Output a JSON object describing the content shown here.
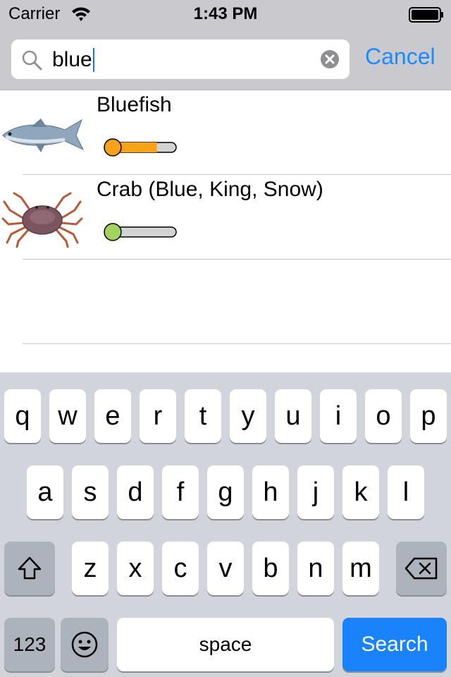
{
  "status_bar": {
    "carrier": "Carrier",
    "time": "1:43 PM"
  },
  "search": {
    "query": "blue",
    "cancel_label": "Cancel"
  },
  "results": [
    {
      "name": "Bluefish",
      "meter_level_percent": 72,
      "meter_color": "#f7a21b"
    },
    {
      "name": "Crab (Blue, King, Snow)",
      "meter_level_percent": 18,
      "meter_color": "#a3d35f"
    }
  ],
  "keyboard": {
    "row1": [
      "q",
      "w",
      "e",
      "r",
      "t",
      "y",
      "u",
      "i",
      "o",
      "p"
    ],
    "row2": [
      "a",
      "s",
      "d",
      "f",
      "g",
      "h",
      "j",
      "k",
      "l"
    ],
    "row3": [
      "z",
      "x",
      "c",
      "v",
      "b",
      "n",
      "m"
    ],
    "numbers_label": "123",
    "space_label": "space",
    "search_label": "Search"
  },
  "colors": {
    "accent": "#1a8cff",
    "search_key": "#1a82fb",
    "keyboard_bg": "#d1d4da",
    "header_bg": "#c9c9ce"
  }
}
